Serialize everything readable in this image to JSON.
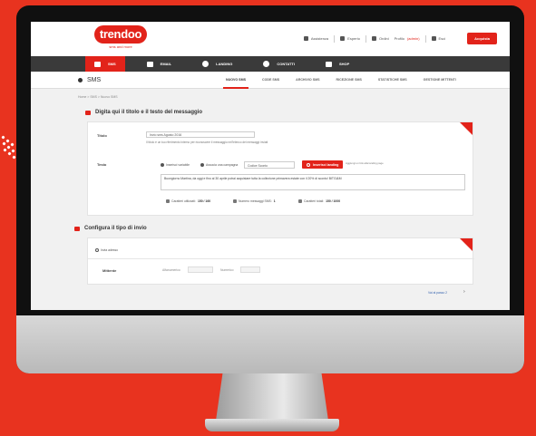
{
  "brand": {
    "logo": "trendoo",
    "tagline": "sms and more"
  },
  "topbar": {
    "items": [
      "Assistenza",
      "Esperto",
      "Ordini"
    ],
    "user": "Profilo",
    "user_link": "(admin)",
    "logout": "Esci",
    "cta": "Acquista"
  },
  "nav": {
    "items": [
      {
        "label": "SMS",
        "icon": "sms-icon"
      },
      {
        "label": "EMAIL",
        "icon": "email-icon"
      },
      {
        "label": "LANDING",
        "icon": "landing-icon"
      },
      {
        "label": "CONTATTI",
        "icon": "contacts-icon"
      },
      {
        "label": "SHOP",
        "icon": "cart-icon"
      }
    ]
  },
  "subheader": {
    "title": "SMS",
    "tabs": [
      "NUOVO SMS",
      "CODE SMS",
      "ARCHIVIO SMS",
      "RICEZIONE SMS",
      "STATISTICHE SMS",
      "GESTIONE MITTENTI"
    ]
  },
  "breadcrumb": "Home > SMS > Nuovo SMS",
  "section1": {
    "title": "Digita qui il titolo e il testo del messaggio",
    "titolo_label": "Titolo",
    "titolo_value": "Invio sms Agosto 2016",
    "titolo_hint": "Il titolo è un tuo riferimento interno per riconoscere il messaggio nell'elenco dei messaggi inviati",
    "testo_label": "Testo",
    "radio1": "Inserisci variabile",
    "radio2": "Associa una campagna",
    "select": "Codice Sconto",
    "button": "Inserisci landing",
    "button_hint": "Aggiungi un link alla landing page",
    "text": "Buongiorno Martina, da oggi e fino al 30 aprile potrai acquistare tutta la collezione primavera estate con il 20% di sconto! BITGI&M",
    "counter1_label": "Caratteri utilizzati:",
    "counter1_value": "150 / 160",
    "counter2_label": "Numero messaggi SMS:",
    "counter2_value": "1",
    "counter3_label": "Caratteri totali:",
    "counter3_value": "150 / 1000"
  },
  "section2": {
    "title": "Configura il tipo di invio",
    "option": "Invia adesso",
    "row_label": "Mittente",
    "pill1_label": "Alfanumerico",
    "pill1_value": "",
    "pill2_label": "Numerico",
    "pill2_value": ""
  },
  "footer_link": "Vai al passo 2"
}
